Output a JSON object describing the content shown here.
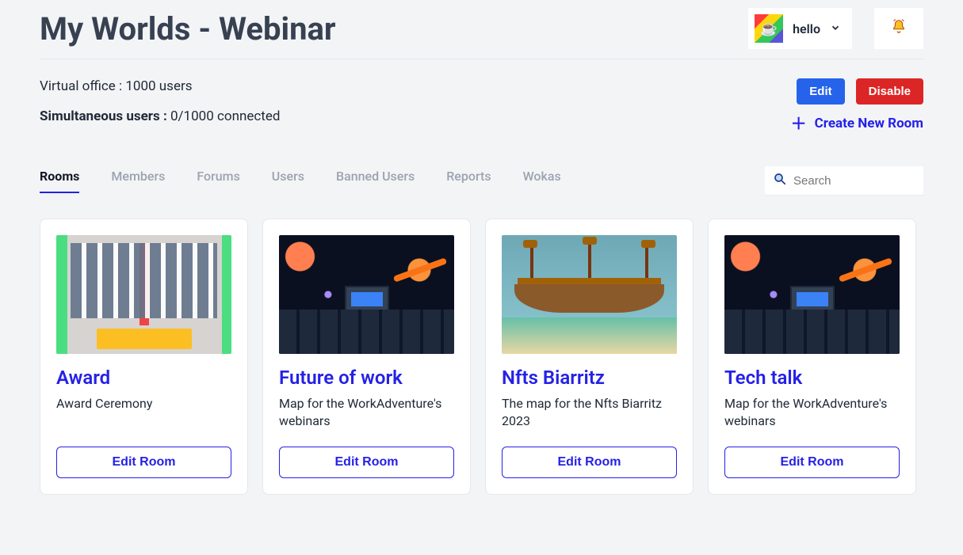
{
  "header": {
    "page_title": "My Worlds - Webinar",
    "user_name": "hello"
  },
  "info": {
    "plan_line_label": "Virtual office",
    "plan_line_value": "1000 users",
    "simul_label": "Simultaneous users :",
    "simul_value": "0/1000 connected"
  },
  "actions": {
    "edit": "Edit",
    "disable": "Disable",
    "create_room": "Create New Room"
  },
  "tabs": [
    {
      "label": "Rooms",
      "active": true
    },
    {
      "label": "Members",
      "active": false
    },
    {
      "label": "Forums",
      "active": false
    },
    {
      "label": "Users",
      "active": false
    },
    {
      "label": "Banned Users",
      "active": false
    },
    {
      "label": "Reports",
      "active": false
    },
    {
      "label": "Wokas",
      "active": false
    }
  ],
  "search": {
    "placeholder": "Search"
  },
  "rooms": [
    {
      "title": "Award",
      "description": "Award Ceremony",
      "edit_label": "Edit Room",
      "thumb": "award"
    },
    {
      "title": "Future of work",
      "description": "Map for the WorkAdventure's webinars",
      "edit_label": "Edit Room",
      "thumb": "space"
    },
    {
      "title": "Nfts Biarritz",
      "description": "The map for the Nfts Biarritz 2023",
      "edit_label": "Edit Room",
      "thumb": "ship"
    },
    {
      "title": "Tech talk",
      "description": "Map for the WorkAdventure's webinars",
      "edit_label": "Edit Room",
      "thumb": "space"
    }
  ]
}
